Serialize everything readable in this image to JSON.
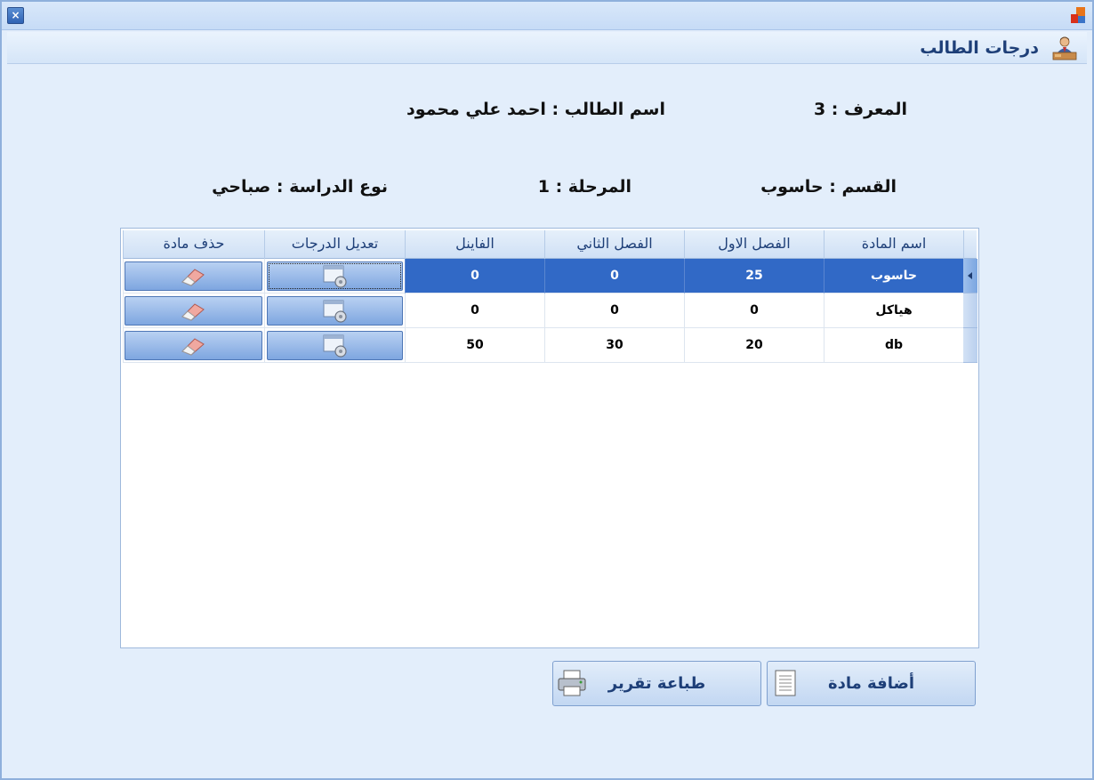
{
  "window": {
    "title": "درجات الطالب",
    "close_label": "×"
  },
  "student": {
    "id_text": "المعرف : 3",
    "name_text": "اسم الطالب : احمد علي محمود",
    "department_text": "القسم : حاسوب",
    "stage_text": "المرحلة : 1",
    "study_type_text": "نوع الدراسة : صباحي"
  },
  "grid": {
    "columns": [
      "اسم المادة",
      "الفصل الاول",
      "الفصل الثاني",
      "الفاينل",
      "تعديل الدرجات",
      "حذف مادة"
    ],
    "rows": [
      {
        "subject": "حاسوب",
        "first": "25",
        "second": "0",
        "final": "0",
        "selected": true
      },
      {
        "subject": "هياكل",
        "first": "0",
        "second": "0",
        "final": "0",
        "selected": false
      },
      {
        "subject": "db",
        "first": "20",
        "second": "30",
        "final": "50",
        "selected": false
      }
    ],
    "edit_icon": "settings-window-icon",
    "delete_icon": "eraser-icon"
  },
  "actions": {
    "add_label": "أضافة مادة",
    "print_label": "طباعة تقرير",
    "add_icon": "document-icon",
    "print_icon": "printer-icon"
  },
  "colors": {
    "selection": "#3169c6",
    "title_text": "#1e3f78",
    "background": "#e3eefb"
  }
}
